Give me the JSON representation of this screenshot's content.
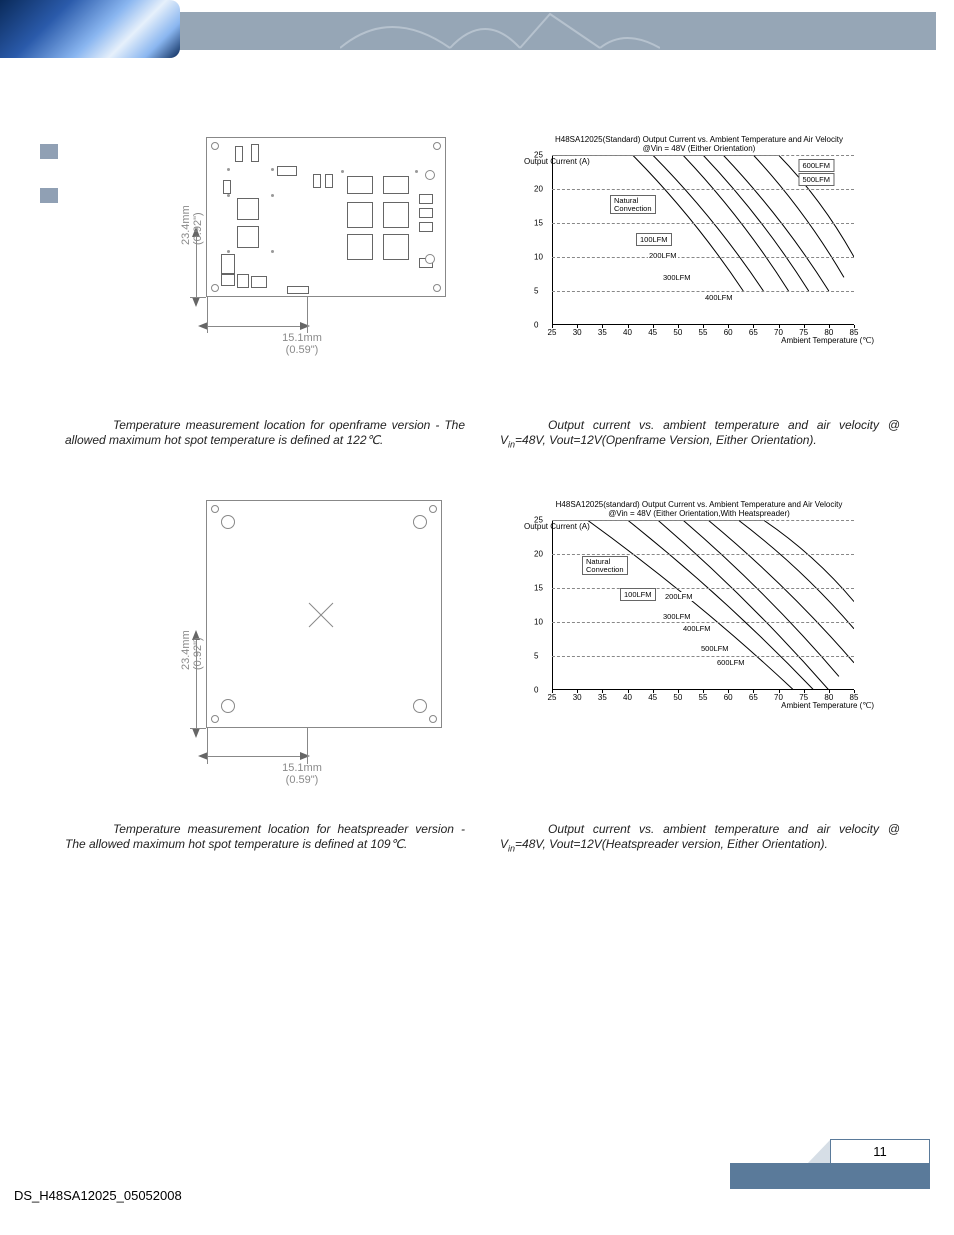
{
  "page_number": "11",
  "document_id": "DS_H48SA12025_05052008",
  "diagrams": {
    "openframe": {
      "dim_v_mm": "23.4mm",
      "dim_v_in": "(0.92\")",
      "dim_h_mm": "15.1mm",
      "dim_h_in": "(0.59\")"
    },
    "heatspreader": {
      "dim_v_mm": "23.4mm",
      "dim_v_in": "(0.92\")",
      "dim_h_mm": "15.1mm",
      "dim_h_in": "(0.59\")"
    }
  },
  "captions": {
    "tl": "Temperature measurement location for openframe version - The allowed maximum hot spot temperature is defined at 122℃.",
    "bl": "Temperature measurement location for heatspreader version - The allowed maximum hot spot temperature is defined at 109℃.",
    "tr_pre": "Output current vs. ambient temperature and air velocity @ V",
    "tr_post": "=48V, Vout=12V(Openframe Version, Either Orientation).",
    "br_pre": "Output current vs. ambient temperature and air velocity @ V",
    "br_post": "=48V, Vout=12V(Heatspreader version, Either Orientation).",
    "sub_in": "in"
  },
  "chart_data": [
    {
      "type": "line",
      "title": "H48SA12025(Standard)  Output Current vs. Ambient Temperature and Air Velocity\n@Vin = 48V (Either Orientation)",
      "ylabel": "Output Current (A)",
      "xlabel": "Ambient Temperature\n(℃)",
      "ylim": [
        0,
        25
      ],
      "xlim": [
        25,
        85
      ],
      "yticks": [
        0,
        5,
        10,
        15,
        20,
        25
      ],
      "xticks": [
        25,
        30,
        35,
        40,
        45,
        50,
        55,
        60,
        65,
        70,
        75,
        80,
        85
      ],
      "series": [
        {
          "name": "Natural Convection",
          "points": [
            [
              25,
              25
            ],
            [
              41,
              25
            ],
            [
              63,
              5
            ]
          ]
        },
        {
          "name": "100LFM",
          "points": [
            [
              25,
              25
            ],
            [
              45,
              25
            ],
            [
              67,
              5
            ]
          ]
        },
        {
          "name": "200LFM",
          "points": [
            [
              25,
              25
            ],
            [
              51,
              25
            ],
            [
              72,
              5
            ]
          ]
        },
        {
          "name": "300LFM",
          "points": [
            [
              25,
              25
            ],
            [
              55,
              25
            ],
            [
              76,
              5
            ]
          ]
        },
        {
          "name": "400LFM",
          "points": [
            [
              25,
              25
            ],
            [
              59,
              25
            ],
            [
              80,
              5
            ]
          ]
        },
        {
          "name": "500LFM",
          "points": [
            [
              25,
              25
            ],
            [
              65,
              25
            ],
            [
              83,
              7
            ]
          ]
        },
        {
          "name": "600LFM",
          "points": [
            [
              25,
              25
            ],
            [
              70,
              25
            ],
            [
              85,
              10
            ]
          ]
        }
      ]
    },
    {
      "type": "line",
      "title": "H48SA12025(standard)  Output Current vs. Ambient Temperature and Air Velocity\n@Vin = 48V (Either Orientation,With Heatspreader)",
      "ylabel": "Output Current (A)",
      "xlabel": "Ambient Temperature\n(℃)",
      "ylim": [
        0,
        25
      ],
      "xlim": [
        25,
        85
      ],
      "yticks": [
        0,
        5,
        10,
        15,
        20,
        25
      ],
      "xticks": [
        25,
        30,
        35,
        40,
        45,
        50,
        55,
        60,
        65,
        70,
        75,
        80,
        85
      ],
      "series": [
        {
          "name": "Natural Convection",
          "points": [
            [
              25,
              25
            ],
            [
              32,
              25
            ],
            [
              73,
              0
            ]
          ]
        },
        {
          "name": "100LFM",
          "points": [
            [
              25,
              25
            ],
            [
              40,
              25
            ],
            [
              77,
              0
            ]
          ]
        },
        {
          "name": "200LFM",
          "points": [
            [
              25,
              25
            ],
            [
              46,
              25
            ],
            [
              80,
              0
            ]
          ]
        },
        {
          "name": "300LFM",
          "points": [
            [
              25,
              25
            ],
            [
              51,
              25
            ],
            [
              82,
              2
            ]
          ]
        },
        {
          "name": "400LFM",
          "points": [
            [
              25,
              25
            ],
            [
              56,
              25
            ],
            [
              85,
              4
            ]
          ]
        },
        {
          "name": "500LFM",
          "points": [
            [
              25,
              25
            ],
            [
              62,
              25
            ],
            [
              85,
              9
            ]
          ]
        },
        {
          "name": "600LFM",
          "points": [
            [
              25,
              25
            ],
            [
              67,
              25
            ],
            [
              85,
              13
            ]
          ]
        }
      ]
    }
  ]
}
